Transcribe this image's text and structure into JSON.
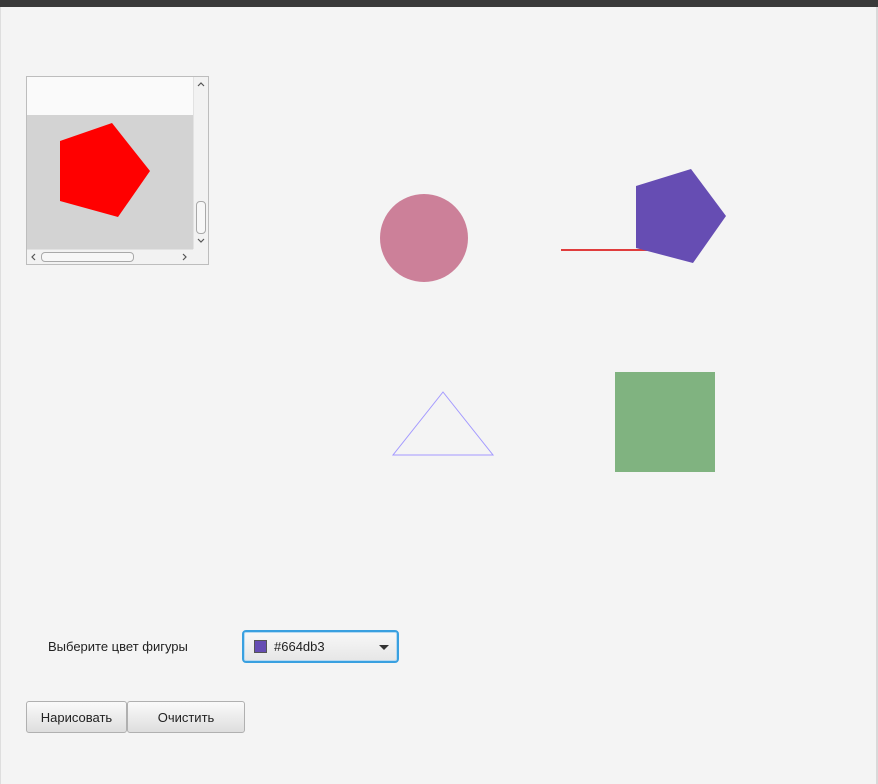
{
  "window": {
    "titlebar_color": "#3a3a3a",
    "background": "#f4f4f4"
  },
  "preview": {
    "header_color": "#fafafa",
    "content_background": "#d3d3d3",
    "pentagon_fill": "#ff0000",
    "icons": [
      "chevron-up-icon",
      "chevron-down-icon",
      "chevron-left-icon",
      "chevron-right-icon"
    ]
  },
  "canvas_shapes": [
    {
      "type": "circle",
      "fill": "#cc8099"
    },
    {
      "type": "line",
      "stroke": "#e03c3c"
    },
    {
      "type": "pentagon",
      "fill": "#664db3"
    },
    {
      "type": "triangle",
      "stroke": "#a399ff",
      "fill": "none"
    },
    {
      "type": "square",
      "fill": "#80b380"
    }
  ],
  "controls": {
    "color_label": "Выберите цвет фигуры",
    "color_picker": {
      "value": "#664db3",
      "swatch_color": "#664db3",
      "icon": "chevron-down-icon"
    },
    "draw_button_label": "Нарисовать",
    "clear_button_label": "Очистить"
  }
}
